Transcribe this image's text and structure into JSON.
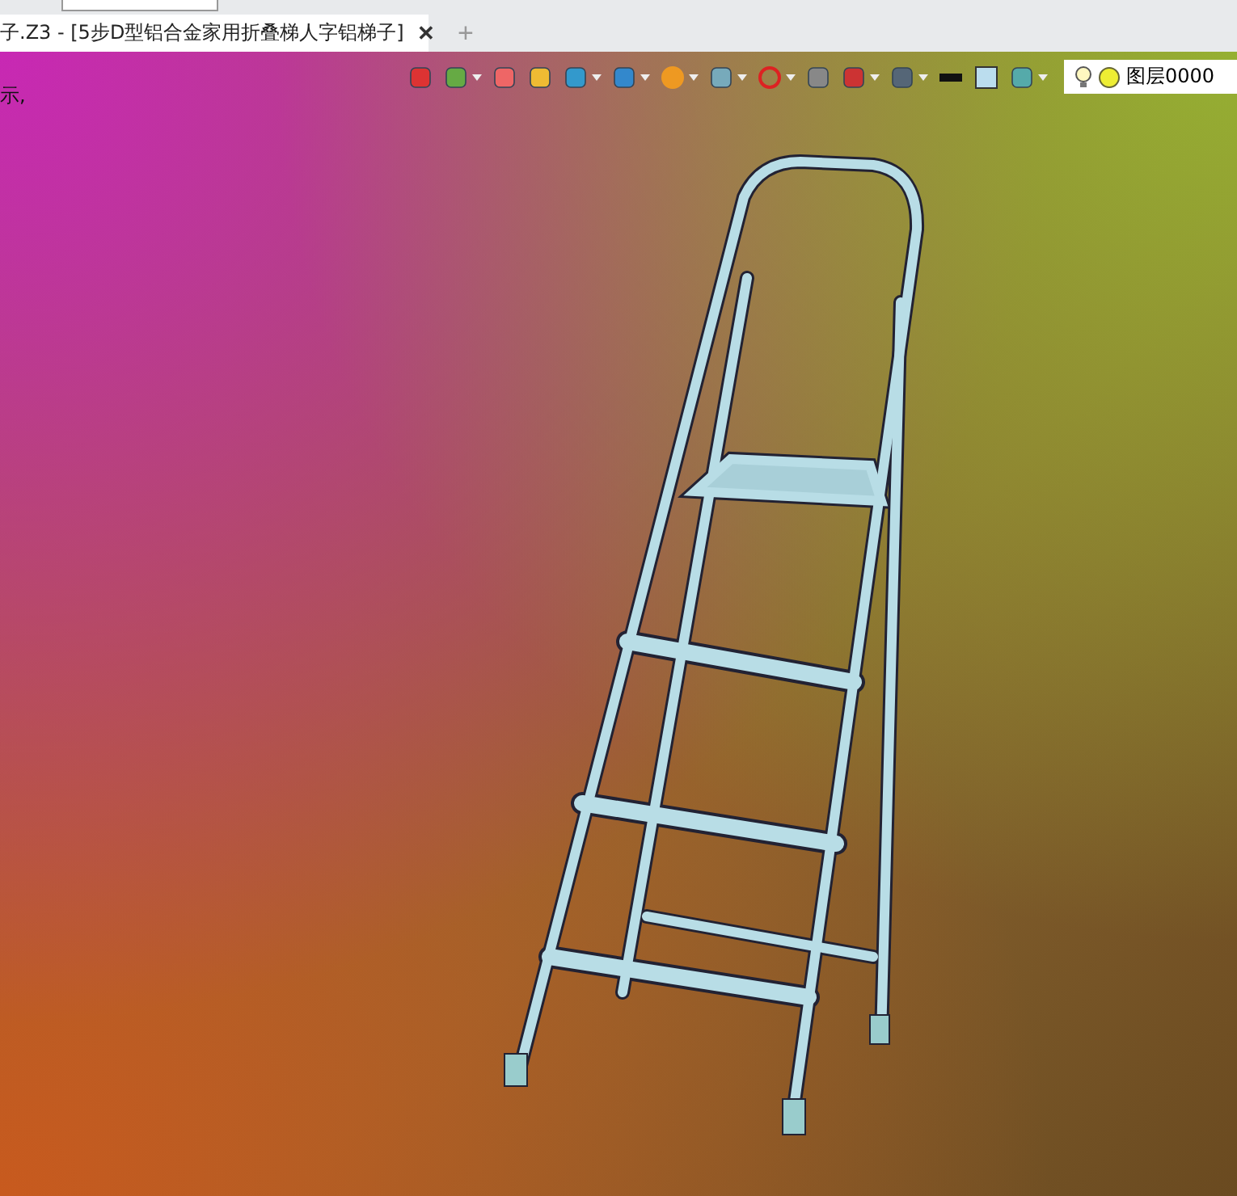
{
  "document_tab": {
    "title": "子.Z3 - [5步D型铝合金家用折叠梯人字铝梯子]",
    "close": "✕",
    "new_tab": "+"
  },
  "viewport": {
    "hint": "示,",
    "toolbar": [
      {
        "dropdown": false
      },
      {
        "dropdown": true
      },
      {
        "dropdown": false
      },
      {
        "dropdown": false
      },
      {
        "dropdown": true
      },
      {
        "dropdown": true
      },
      {
        "dropdown": true
      },
      {
        "dropdown": true
      },
      {
        "dropdown": true
      },
      {
        "dropdown": false
      },
      {
        "dropdown": true
      },
      {
        "dropdown": true
      },
      {
        "dropdown": false
      },
      {
        "dropdown": false
      },
      {
        "dropdown": true
      }
    ],
    "layer_field": {
      "value": "图层0000"
    }
  }
}
